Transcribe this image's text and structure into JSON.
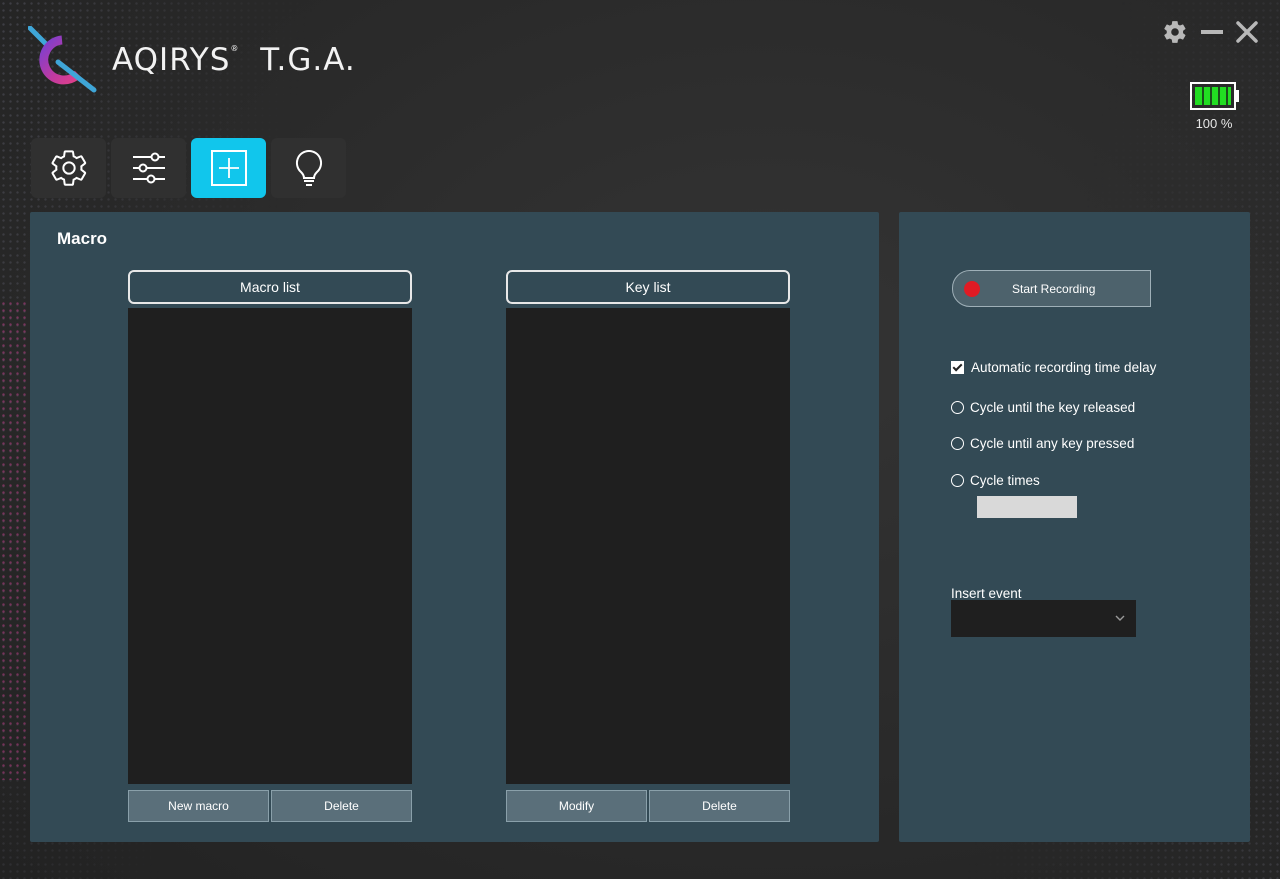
{
  "app": {
    "logo_text": "AQIRYS",
    "logo_reg": "®",
    "logo_suffix": "T.G.A."
  },
  "window_controls": {
    "settings_icon": "gear-icon",
    "minimize_icon": "minimize-icon",
    "close_icon": "close-icon"
  },
  "battery": {
    "level": 100,
    "text": "100 %",
    "color": "#22dd22"
  },
  "tabs": [
    {
      "icon": "gear-icon",
      "active": false
    },
    {
      "icon": "sliders-icon",
      "active": false
    },
    {
      "icon": "add-square-icon",
      "active": true
    },
    {
      "icon": "lightbulb-icon",
      "active": false
    }
  ],
  "colors": {
    "accent": "#11c6ec",
    "panel": "#334a55",
    "record": "#e01b24"
  },
  "macro_panel": {
    "title": "Macro",
    "macro_list": {
      "header": "Macro list",
      "items": [],
      "new_label": "New macro",
      "delete_label": "Delete"
    },
    "key_list": {
      "header": "Key list",
      "items": [],
      "modify_label": "Modify",
      "delete_label": "Delete"
    }
  },
  "side_panel": {
    "record_label": "Start Recording",
    "auto_delay_label": "Automatic recording time delay",
    "auto_delay_checked": true,
    "cycle_released_label": "Cycle until the key released",
    "cycle_any_label": "Cycle until any key pressed",
    "cycle_times_label": "Cycle times",
    "cycle_times_value": "",
    "insert_event_label": "Insert event",
    "insert_event_value": ""
  }
}
